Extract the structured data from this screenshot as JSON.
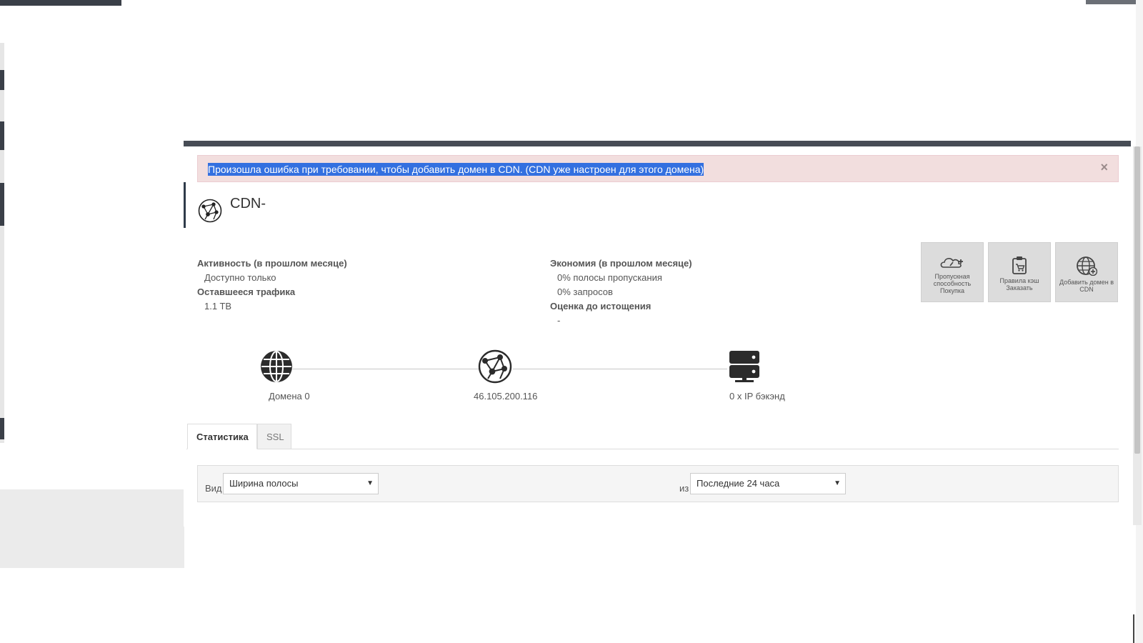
{
  "alert": {
    "message": "Произошла ошибка при требовании, чтобы добавить домен в CDN. (CDN уже настроен для этого домена)",
    "close": "×"
  },
  "header": {
    "title": "CDN-"
  },
  "stats": {
    "activity_label": "Активность (в прошлом месяце)",
    "activity_value": "Доступно только",
    "remaining_label": "Оставшееся трафика",
    "remaining_value": "1.1 TB",
    "savings_label": "Экономия (в прошлом месяце)",
    "savings_bandwidth": "0% полосы пропускания",
    "savings_requests": "0% запросов",
    "estimate_label": "Оценка до истощения",
    "estimate_value": "-"
  },
  "actions": [
    {
      "label": "Пропускная способность Покупка",
      "icon": "cloud-speed-icon"
    },
    {
      "label": "Правила кэш Заказать",
      "icon": "clipboard-cart-icon"
    },
    {
      "label": "Добавить домен в CDN",
      "icon": "globe-plus-icon"
    }
  ],
  "topology": {
    "domains": "Домена 0",
    "ip": "46.105.200.116",
    "backend": "0 x IP бэкэнд"
  },
  "tabs": {
    "stats": "Статистика",
    "ssl": "SSL"
  },
  "filter": {
    "view_label": "Вид",
    "view_value": "Ширина полосы",
    "period_label": "из",
    "period_value": "Последние 24 часа"
  },
  "colors": {
    "alert_bg": "#f2dede",
    "selection": "#3370e0",
    "panel_bar": "#474c55"
  }
}
